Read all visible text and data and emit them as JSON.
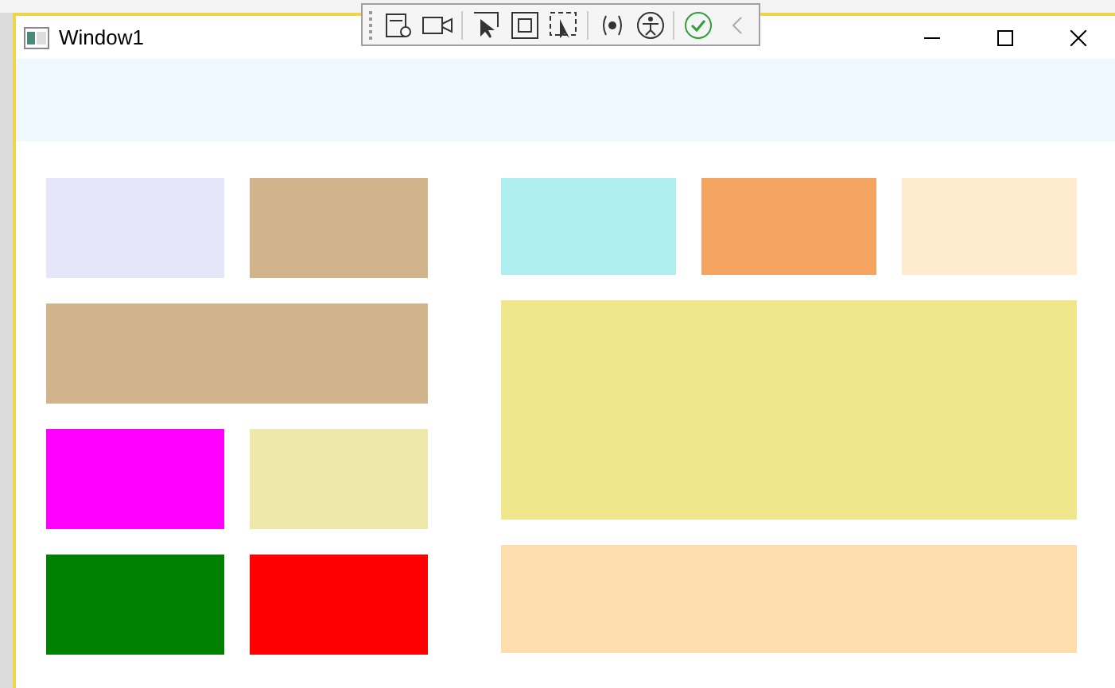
{
  "window": {
    "title": "Window1"
  },
  "left_panel": {
    "blocks": [
      {
        "kind": "single",
        "color": "#e6e6fa"
      },
      {
        "kind": "single",
        "color": "#d2b48c"
      },
      {
        "kind": "wide",
        "color": "#d2b48c"
      },
      {
        "kind": "single",
        "color": "#ff00ff"
      },
      {
        "kind": "single",
        "color": "#eee8aa"
      },
      {
        "kind": "single",
        "color": "#008000"
      },
      {
        "kind": "single",
        "color": "#ff0000"
      }
    ]
  },
  "right_panel": {
    "blocks": [
      {
        "kind": "single",
        "color": "#afeeee"
      },
      {
        "kind": "single",
        "color": "#f4a460"
      },
      {
        "kind": "single",
        "color": "#ffebcd"
      },
      {
        "kind": "large",
        "color": "#f0e68c"
      },
      {
        "kind": "wide",
        "color": "#ffdead"
      }
    ]
  }
}
